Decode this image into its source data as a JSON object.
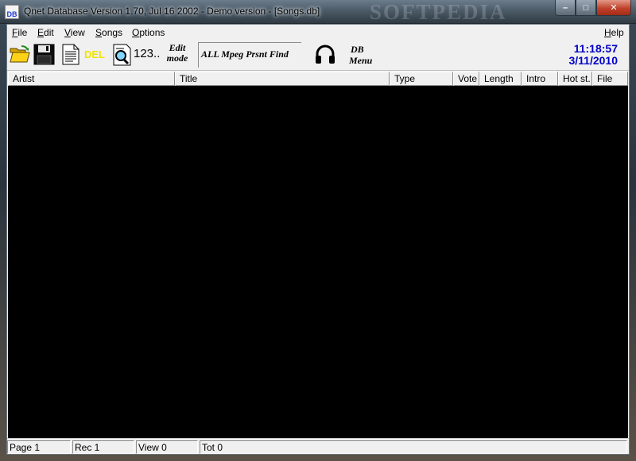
{
  "window": {
    "app_icon_text": "DB",
    "title": "Qnet Database Version 1.70, Jul 16 2002 - Demo version - [Songs.db]",
    "watermark": "SOFTPEDIA",
    "minimize_glyph": "–",
    "maximize_glyph": "□",
    "close_glyph": "✕"
  },
  "menu": {
    "items": [
      {
        "label": "File",
        "hotkey": "F",
        "rest": "ile"
      },
      {
        "label": "Edit",
        "hotkey": "E",
        "rest": "dit"
      },
      {
        "label": "View",
        "hotkey": "V",
        "rest": "iew"
      },
      {
        "label": "Songs",
        "hotkey": "S",
        "rest": "ongs"
      },
      {
        "label": "Options",
        "hotkey": "O",
        "rest": "ptions"
      }
    ],
    "help": {
      "label": "Help",
      "hotkey": "H",
      "rest": "elp"
    }
  },
  "toolbar": {
    "del_label": "DEL",
    "count_label": "123..",
    "edit_mode_line1": "Edit",
    "edit_mode_line2": "mode",
    "filter_label": "ALL Mpeg Prsnt Find",
    "db_menu_line1": "DB",
    "db_menu_line2": "Menu",
    "clock_time": "11:18:57",
    "clock_date": "3/11/2010",
    "icons": [
      "open-folder-icon",
      "save-disk-icon",
      "document-icon",
      "search-magnifier-icon",
      "headphones-icon"
    ]
  },
  "table": {
    "columns": [
      "Artist",
      "Title",
      "Type",
      "Vote",
      "Length",
      "Intro",
      "Hot st.",
      "File"
    ],
    "rows": []
  },
  "status": {
    "page": "Page 1",
    "rec": "Rec 1",
    "view": "View 0",
    "tot": "Tot 0"
  },
  "colors": {
    "grid_background": "#000000",
    "clock": "#0000c8",
    "del_label": "#f0e400",
    "chrome": "#f0f0f0"
  }
}
